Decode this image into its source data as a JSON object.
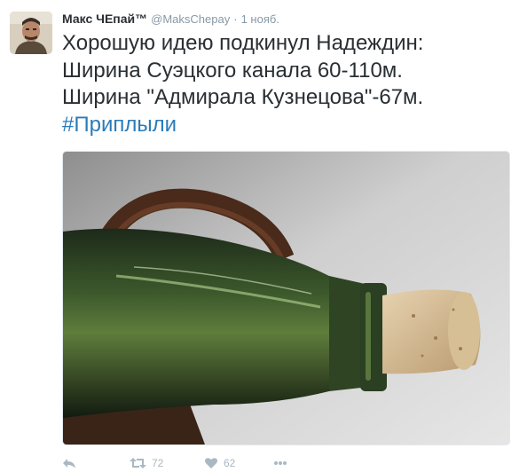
{
  "tweet": {
    "author": {
      "fullname": "Макс ЧЕпай™",
      "username": "@MaksChepay",
      "separator": "·",
      "time": "1 нояб."
    },
    "text_lines": [
      "Хорошую идею подкинул Надеждин:",
      "Ширина Суэцкого канала 60-110м.",
      "Ширина \"Адмирала Кузнецова\"-67м."
    ],
    "hashtag": "#Приплыли",
    "actions": {
      "retweet_count": "72",
      "like_count": "62"
    }
  },
  "colors": {
    "link": "#2b7bb9",
    "text": "#292f33",
    "meta": "#8899a6",
    "action": "#aab8c2"
  }
}
